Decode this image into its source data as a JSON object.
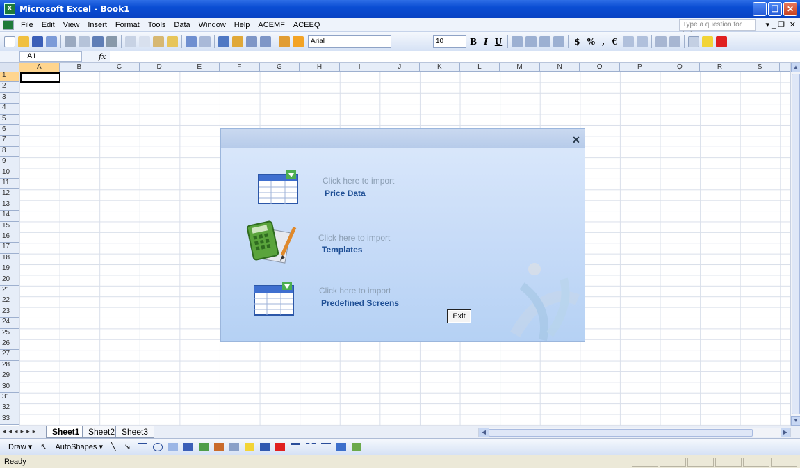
{
  "window": {
    "title": "Microsoft Excel - Book1",
    "app_icon_letter": "X"
  },
  "menu": {
    "items": [
      "File",
      "Edit",
      "View",
      "Insert",
      "Format",
      "Tools",
      "Data",
      "Window",
      "Help",
      "ACEMF",
      "ACEEQ"
    ],
    "help_placeholder": "Type a question for help"
  },
  "toolbar": {
    "font_name": "Arial",
    "font_size": "10",
    "bold": "B",
    "italic": "I",
    "underline": "U",
    "currency": "$",
    "percent": "%",
    "comma": ",",
    "euro": "€"
  },
  "formula_bar": {
    "cell_ref": "A1",
    "fx": "fx",
    "value": ""
  },
  "grid": {
    "columns": [
      "A",
      "B",
      "C",
      "D",
      "E",
      "F",
      "G",
      "H",
      "I",
      "J",
      "K",
      "L",
      "M",
      "N",
      "O",
      "P",
      "Q",
      "R",
      "S"
    ],
    "rows": [
      "1",
      "2",
      "3",
      "4",
      "5",
      "6",
      "7",
      "8",
      "9",
      "10",
      "11",
      "12",
      "13",
      "14",
      "15",
      "16",
      "17",
      "18",
      "19",
      "20",
      "21",
      "22",
      "23",
      "24",
      "25",
      "26",
      "27",
      "28",
      "29",
      "30",
      "31",
      "32",
      "33"
    ],
    "active_cell": "A1"
  },
  "sheets": [
    "Sheet1",
    "Sheet2",
    "Sheet3"
  ],
  "active_sheet": "Sheet1",
  "draw_toolbar": {
    "draw": "Draw",
    "autoshapes": "AutoShapes"
  },
  "status": {
    "text": "Ready"
  },
  "dialog": {
    "close_symbol": "✕",
    "items": [
      {
        "caption": "Click here to import",
        "label": "Price Data",
        "icon": "table-import-icon"
      },
      {
        "caption": "Click here to import",
        "label": "Templates",
        "icon": "calculator-icon"
      },
      {
        "caption": "Click here to import",
        "label": "Predefined Screens",
        "icon": "table-import-icon"
      }
    ],
    "exit_label": "Exit"
  },
  "colors": {
    "titlebar": "#0a4dd3",
    "active_header": "#ffd58e",
    "dialog_label": "#1f4f95"
  }
}
